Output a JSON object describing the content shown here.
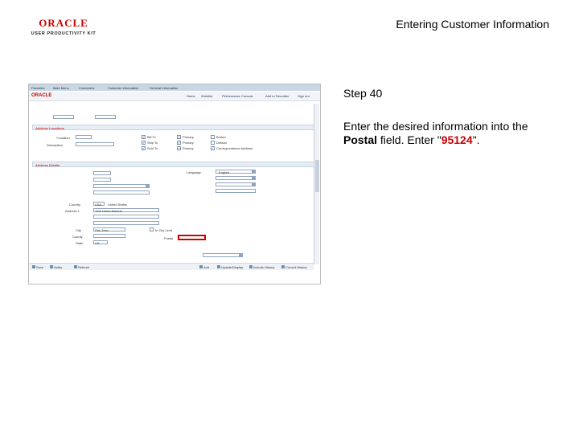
{
  "logo": {
    "oracle": "ORACLE",
    "upk": "USER PRODUCTIVITY KIT"
  },
  "slide": {
    "title": "Entering Customer Information",
    "step": "Step 40",
    "instruction_prefix": "Enter the desired information into the ",
    "field_name": "Postal",
    "instruction_middle": " field. Enter \"",
    "value": "95124",
    "instruction_suffix": "\"."
  },
  "screenshot": {
    "breadcrumb": [
      "Favorites",
      "Main Menu",
      "Customers",
      "Customer Information",
      "General Information"
    ],
    "org": "ORACLE",
    "toplinks": [
      "Home",
      "Worklist",
      "Performance Console",
      "Add to Favorites",
      "Sign out"
    ],
    "section1": "Address Locations",
    "section2": "Address Details",
    "fields": {
      "location_label": "*Location",
      "location_value": "1",
      "description_label": "Description",
      "country_label": "Country",
      "country_code": "USA",
      "country_name": "United States",
      "address1_label": "Address 1",
      "address1_value": "1111 Union Avenue",
      "city_label": "City",
      "city_value": "San Jose",
      "county_label": "County",
      "state_label": "State",
      "state_value": "CA",
      "postal_label": "Postal",
      "in_city_limit": "In City Limit",
      "language_label": "Language",
      "language_value": "English"
    },
    "checkboxes": [
      "Bill To",
      "Ship To",
      "Sold To",
      "Primary",
      "Primary",
      "Primary",
      "Broker",
      "Default",
      "Correspondence Address"
    ],
    "buttons": [
      "Save",
      "Notify",
      "Refresh",
      "Add",
      "Update/Display",
      "Include History",
      "Correct History"
    ]
  }
}
